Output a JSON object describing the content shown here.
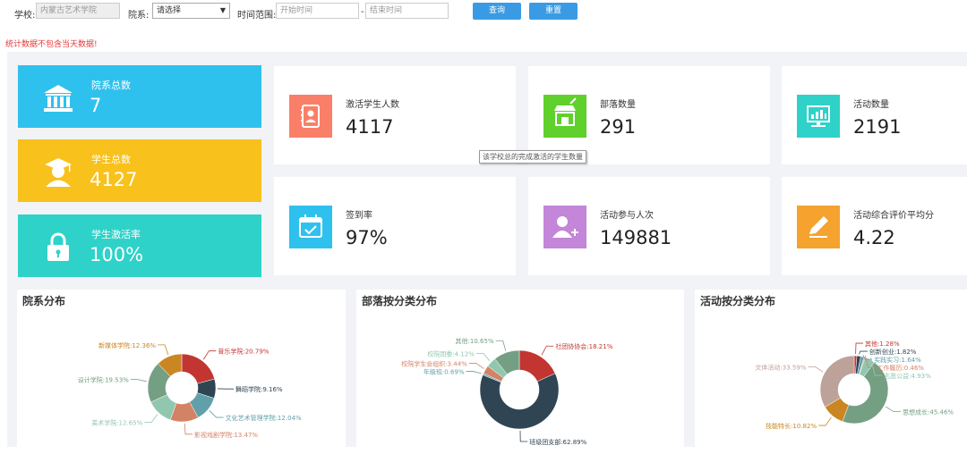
{
  "filter": {
    "school_label": "学校:",
    "school_value": "内蒙古艺术学院",
    "dept_label": "院系:",
    "dept_value": "请选择",
    "time_label": "时间范围:",
    "start_placeholder": "开始时间",
    "separator": "-",
    "end_placeholder": "结束时间",
    "query_label": "查询",
    "reset_label": "重置"
  },
  "notice": "统计数据不包含当天数据!",
  "big_cards": [
    {
      "label": "院系总数",
      "value": "7",
      "icon": "building-icon",
      "color": "#2fc1ee"
    },
    {
      "label": "学生总数",
      "value": "4127",
      "icon": "graduate-icon",
      "color": "#f8c11b"
    },
    {
      "label": "学生激活率",
      "value": "100%",
      "icon": "lock-icon",
      "color": "#2ed2c9"
    }
  ],
  "stats": [
    {
      "label": "激活学生人数",
      "value": "4117",
      "icon": "contact-book-icon",
      "color": "#fa7f68"
    },
    {
      "label": "部落数量",
      "value": "291",
      "icon": "shop-icon",
      "color": "#5fd02c"
    },
    {
      "label": "活动数量",
      "value": "2191",
      "icon": "monitor-chart-icon",
      "color": "#2ed2c9"
    },
    {
      "label": "签到率",
      "value": "97%",
      "icon": "calendar-check-icon",
      "color": "#2fc1ee"
    },
    {
      "label": "活动参与人次",
      "value": "149881",
      "icon": "add-user-icon",
      "color": "#c386d8"
    },
    {
      "label": "活动综合评价平均分",
      "value": "4.22",
      "icon": "pencil-icon",
      "color": "#f5a22e"
    }
  ],
  "tooltip": "该学校总的完成激活的学生数量",
  "chart_data": [
    {
      "type": "pie",
      "title": "院系分布",
      "categories": [
        "音乐学院",
        "舞蹈学院",
        "文化艺术管理学院",
        "影视戏剧学院",
        "美术学院",
        "设计学院",
        "新媒体学院"
      ],
      "values": [
        20.79,
        9.16,
        12.04,
        13.47,
        12.65,
        19.53,
        12.36
      ],
      "labels": [
        "音乐学院:20.79%",
        "舞蹈学院:9.16%",
        "文化艺术管理学院:12.04%",
        "影视戏剧学院:13.47%",
        "美术学院:12.65%",
        "设计学院:19.53%",
        "新媒体学院:12.36%"
      ],
      "colors": [
        "#c23531",
        "#2f4554",
        "#61a0a8",
        "#d48265",
        "#91c7ae",
        "#749f83",
        "#ca8622"
      ],
      "donut": true
    },
    {
      "type": "pie",
      "title": "部落按分类分布",
      "categories": [
        "社团协协会",
        "班级团支部",
        "年级班",
        "校院学生会组织",
        "校院团委",
        "其他"
      ],
      "values": [
        18.21,
        62.89,
        0.69,
        3.44,
        4.12,
        10.65
      ],
      "labels": [
        "社团协协会:18.21%",
        "班级团支部:62.89%",
        "年级班:0.69%",
        "校院学生会组织:3.44%",
        "校院团委:4.12%",
        "其他:10.65%"
      ],
      "colors": [
        "#c23531",
        "#2f4554",
        "#61a0a8",
        "#d48265",
        "#91c7ae",
        "#749f83"
      ],
      "donut": true
    },
    {
      "type": "pie",
      "title": "活动按分类分布",
      "categories": [
        "其他",
        "创新创业",
        "实践实习",
        "工作履历",
        "志愿公益",
        "思想成长",
        "技能特长",
        "文体活动"
      ],
      "values": [
        1.28,
        1.82,
        1.64,
        0.46,
        4.93,
        45.46,
        10.82,
        33.59
      ],
      "labels": [
        "其他:1.28%",
        "创新创业:1.82%",
        "实践实习:1.64%",
        "工作履历:0.46%",
        "志愿公益:4.93%",
        "思想成长:45.46%",
        "技能特长:10.82%",
        "文体活动:33.59%"
      ],
      "colors": [
        "#c23531",
        "#2f4554",
        "#61a0a8",
        "#d48265",
        "#91c7ae",
        "#749f83",
        "#ca8622",
        "#bda29a"
      ],
      "donut": true
    }
  ]
}
